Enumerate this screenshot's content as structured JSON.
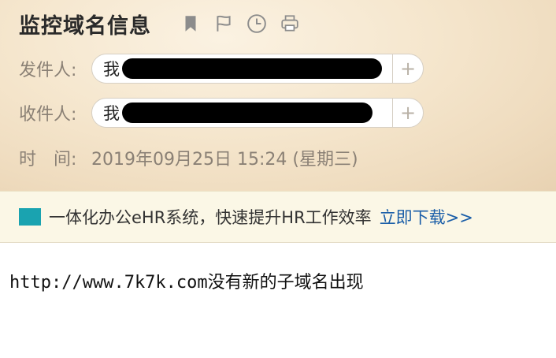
{
  "email": {
    "subject": "监控域名信息",
    "icons": [
      "bookmark-icon",
      "flag-icon",
      "clock-icon",
      "print-icon"
    ],
    "from_label": "发件人:",
    "from_value": "我",
    "to_label": "收件人:",
    "to_value": "我",
    "time_label": "时　间:",
    "time_value": "2019年09月25日 15:24 (星期三)",
    "plus": "+"
  },
  "ad": {
    "text": "一体化办公eHR系统，快速提升HR工作效率",
    "link": "立即下载>>",
    "logo_color": "#1aa3b0"
  },
  "body": {
    "url": "http://www.7k7k.com",
    "message": "没有新的子域名出现"
  }
}
